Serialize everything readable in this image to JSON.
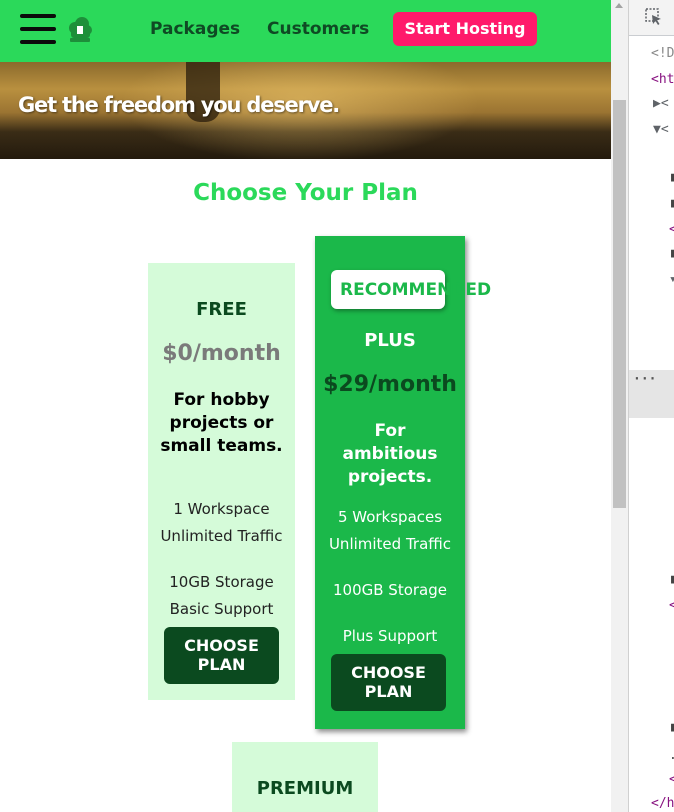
{
  "header": {
    "menu_icon": "hamburger-icon",
    "logo_icon": "cloud-logo-icon",
    "nav": [
      "Packages",
      "Customers"
    ],
    "cta_label": "Start Hosting",
    "bg_color": "#2bd95a",
    "cta_color": "#ff1a6b"
  },
  "hero": {
    "tagline": "Get the freedom you deserve."
  },
  "pricing": {
    "title": "Choose Your Plan",
    "plans": [
      {
        "name": "FREE",
        "price": "$0/month",
        "description": "For hobby projects or small teams.",
        "features": [
          "1 Workspace",
          "Unlimited Traffic",
          "10GB Storage",
          "Basic Support"
        ],
        "button": "CHOOSE PLAN"
      },
      {
        "badge": "RECOMMENDED",
        "name": "PLUS",
        "price": "$29/month",
        "description": "For ambitious projects.",
        "features": [
          "5 Workspaces",
          "Unlimited Traffic",
          "100GB Storage",
          "Plus Support"
        ],
        "button": "CHOOSE PLAN"
      },
      {
        "name": "PREMIUM"
      }
    ]
  },
  "devtools": {
    "inspect_icon": "inspect-element-icon",
    "lines": [
      "<!D",
      "<ht",
      "▶<",
      "▼<",
      "",
      "",
      "",
      "",
      "",
      "",
      "",
      "",
      "",
      "",
      "",
      "",
      "",
      "",
      "<",
      "",
      "",
      "",
      "",
      "",
      "<",
      "</h"
    ],
    "dots": "···"
  }
}
